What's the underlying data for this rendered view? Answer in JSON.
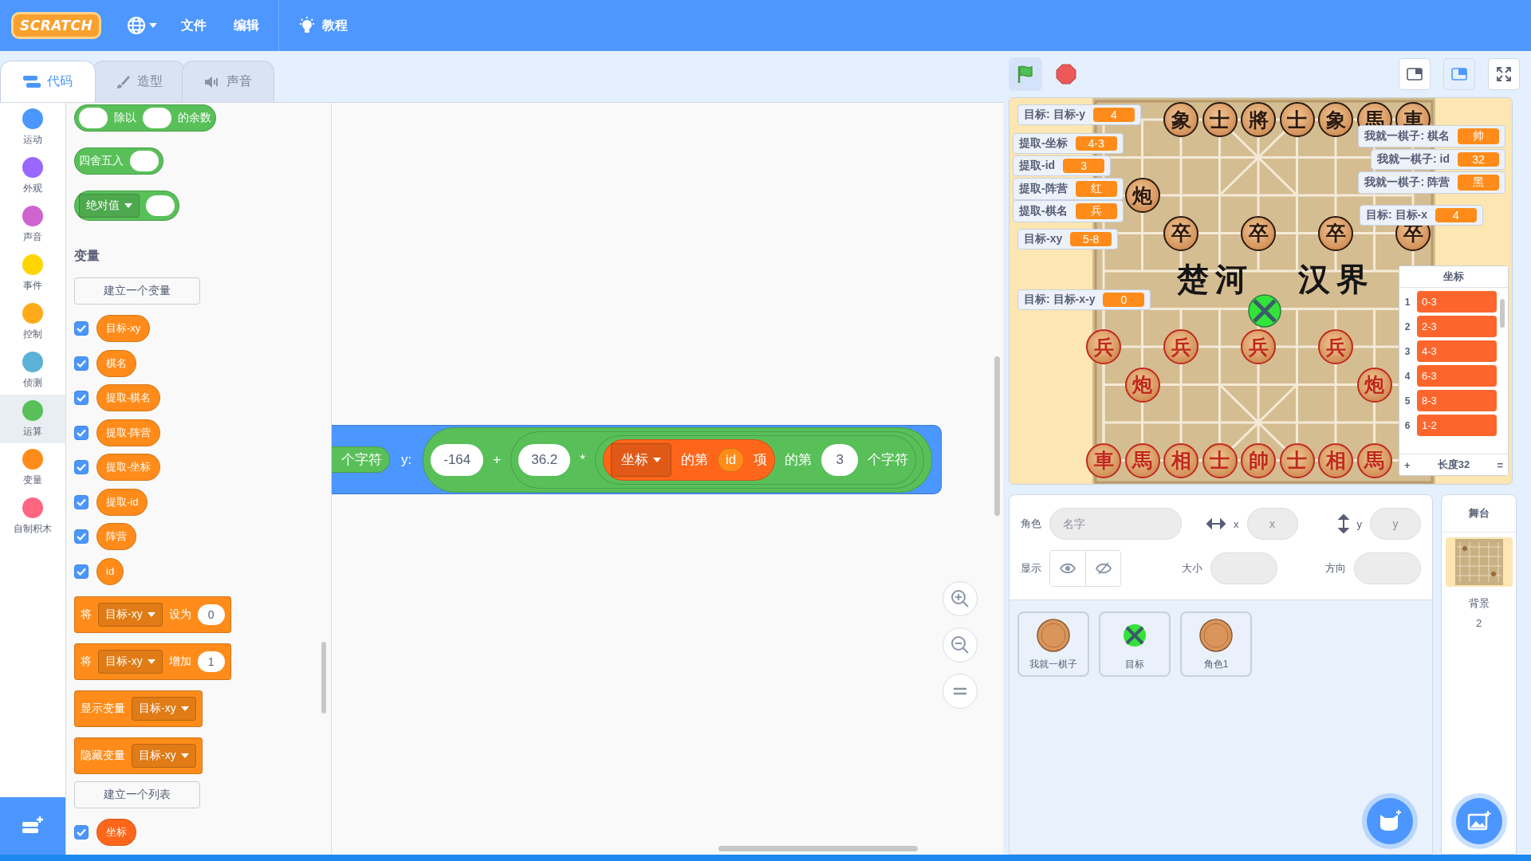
{
  "menu_bar": {
    "logo": "SCRATCH",
    "items": [
      {
        "label": "文件"
      },
      {
        "label": "编辑"
      }
    ],
    "tutorials": "教程"
  },
  "tabs": [
    {
      "label": "代码",
      "selected": true
    },
    {
      "label": "造型",
      "selected": false
    },
    {
      "label": "声音",
      "selected": false
    }
  ],
  "categories": [
    {
      "label": "运动",
      "color": "#4c97ff",
      "selected": false
    },
    {
      "label": "外观",
      "color": "#9966ff",
      "selected": false
    },
    {
      "label": "声音",
      "color": "#cf63cf",
      "selected": false
    },
    {
      "label": "事件",
      "color": "#ffd500",
      "selected": false
    },
    {
      "label": "控制",
      "color": "#ffab19",
      "selected": false
    },
    {
      "label": "侦测",
      "color": "#5cb1d6",
      "selected": false
    },
    {
      "label": "运算",
      "color": "#59c059",
      "selected": true
    },
    {
      "label": "变量",
      "color": "#ff8c1a",
      "selected": false
    },
    {
      "label": "自制积木",
      "color": "#ff6680",
      "selected": false
    }
  ],
  "palette": {
    "items": [
      {
        "kind": "reporter",
        "color": "#59c059",
        "parts": [
          {
            "kind": "slot"
          },
          {
            "kind": "text",
            "text": "除以"
          },
          {
            "kind": "slot"
          },
          {
            "kind": "text",
            "text": "的余数"
          }
        ]
      },
      {
        "kind": "reporter",
        "color": "#59c059",
        "parts": [
          {
            "kind": "text",
            "text": "四舍五入"
          },
          {
            "kind": "slot"
          }
        ]
      },
      {
        "kind": "reporter",
        "color": "#59c059",
        "parts": [
          {
            "kind": "dropdown",
            "text": "绝对值"
          },
          {
            "kind": "slot"
          }
        ]
      },
      {
        "kind": "heading",
        "text": "变量"
      },
      {
        "kind": "button",
        "label": "建立一个变量"
      },
      {
        "kind": "checkbox",
        "label": "目标-xy",
        "checked": true,
        "color": "#ff8c1a"
      },
      {
        "kind": "checkbox",
        "label": "棋名",
        "checked": true,
        "color": "#ff8c1a"
      },
      {
        "kind": "checkbox",
        "label": "提取-棋名",
        "checked": true,
        "color": "#ff8c1a"
      },
      {
        "kind": "checkbox",
        "label": "提取-阵营",
        "checked": true,
        "color": "#ff8c1a"
      },
      {
        "kind": "checkbox",
        "label": "提取-坐标",
        "checked": true,
        "color": "#ff8c1a"
      },
      {
        "kind": "checkbox",
        "label": "提取-id",
        "checked": true,
        "color": "#ff8c1a"
      },
      {
        "kind": "checkbox",
        "label": "阵营",
        "checked": true,
        "color": "#ff8c1a"
      },
      {
        "kind": "checkbox",
        "label": "id",
        "checked": true,
        "color": "#ff8c1a"
      },
      {
        "kind": "command",
        "color": "#ff8c1a",
        "parts": [
          {
            "kind": "text",
            "text": "将"
          },
          {
            "kind": "dropdown",
            "text": "目标-xy"
          },
          {
            "kind": "text",
            "text": "设为"
          },
          {
            "kind": "input",
            "text": "0"
          }
        ]
      },
      {
        "kind": "command",
        "color": "#ff8c1a",
        "parts": [
          {
            "kind": "text",
            "text": "将"
          },
          {
            "kind": "dropdown",
            "text": "目标-xy"
          },
          {
            "kind": "text",
            "text": "增加"
          },
          {
            "kind": "input",
            "text": "1"
          }
        ]
      },
      {
        "kind": "command",
        "color": "#ff8c1a",
        "parts": [
          {
            "kind": "text",
            "text": "显示变量"
          },
          {
            "kind": "dropdown",
            "text": "目标-xy"
          }
        ]
      },
      {
        "kind": "command",
        "color": "#ff8c1a",
        "parts": [
          {
            "kind": "text",
            "text": "隐藏变量"
          },
          {
            "kind": "dropdown",
            "text": "目标-xy"
          }
        ]
      },
      {
        "kind": "button",
        "label": "建立一个列表"
      },
      {
        "kind": "checkbox",
        "label": "坐标",
        "checked": true,
        "color": "#ff661a"
      }
    ]
  },
  "script": {
    "kind": "stack",
    "color": "#4c97ff",
    "parts": [
      {
        "kind": "reporter",
        "color": "#59c059",
        "parts": [
          {
            "kind": "text",
            "text": "个字符"
          }
        ]
      },
      {
        "kind": "text",
        "text": "y:"
      },
      {
        "kind": "reporter",
        "color": "#59c059",
        "parts": [
          {
            "kind": "input",
            "text": "-164"
          },
          {
            "kind": "text",
            "text": "+"
          },
          {
            "kind": "reporter",
            "color": "#59c059",
            "parts": [
              {
                "kind": "input",
                "text": "36.2"
              },
              {
                "kind": "text",
                "text": "*"
              },
              {
                "kind": "reporter",
                "color": "#59c059",
                "parts": [
                  {
                    "kind": "reporter",
                    "color": "#ff661a",
                    "parts": [
                      {
                        "kind": "dropdown",
                        "text": "坐标"
                      },
                      {
                        "kind": "text",
                        "text": "的第"
                      },
                      {
                        "kind": "reporter",
                        "color": "#ff8c1a",
                        "parts": [
                          {
                            "kind": "text",
                            "text": "id"
                          }
                        ]
                      },
                      {
                        "kind": "text",
                        "text": "项"
                      }
                    ]
                  },
                  {
                    "kind": "text",
                    "text": "的第"
                  },
                  {
                    "kind": "input",
                    "text": "3"
                  },
                  {
                    "kind": "text",
                    "text": "个字符"
                  }
                ]
              }
            ]
          }
        ]
      }
    ]
  },
  "stage_modes": [
    {
      "kind": "small",
      "selected": false
    },
    {
      "kind": "normal",
      "selected": true
    }
  ],
  "stage": {
    "board": {
      "river_left": "楚河",
      "river_right": "汉界",
      "pieces": [
        {
          "char": "象",
          "color": "#2a1a10"
        },
        {
          "char": "士",
          "color": "#2a1a10"
        },
        {
          "char": "將",
          "color": "#2a1a10"
        },
        {
          "char": "士",
          "color": "#2a1a10"
        },
        {
          "char": "象",
          "color": "#2a1a10"
        },
        {
          "char": "馬",
          "color": "#2a1a10"
        },
        {
          "char": "車",
          "color": "#2a1a10"
        },
        {
          "char": "炮",
          "color": "#2a1a10"
        },
        {
          "char": "卒",
          "color": "#2a1a10"
        },
        {
          "char": "卒",
          "color": "#2a1a10"
        },
        {
          "char": "卒",
          "color": "#2a1a10"
        },
        {
          "char": "卒",
          "color": "#2a1a10"
        },
        {
          "char": "兵",
          "color": "#c0281e"
        },
        {
          "char": "兵",
          "color": "#c0281e"
        },
        {
          "char": "兵",
          "color": "#c0281e"
        },
        {
          "char": "兵",
          "color": "#c0281e"
        },
        {
          "char": "炮",
          "color": "#c0281e"
        },
        {
          "char": "炮",
          "color": "#c0281e"
        },
        {
          "char": "車",
          "color": "#c0281e"
        },
        {
          "char": "馬",
          "color": "#c0281e"
        },
        {
          "char": "相",
          "color": "#c0281e"
        },
        {
          "char": "士",
          "color": "#c0281e"
        },
        {
          "char": "帥",
          "color": "#c0281e"
        },
        {
          "char": "士",
          "color": "#c0281e"
        },
        {
          "char": "相",
          "color": "#c0281e"
        },
        {
          "char": "馬",
          "color": "#c0281e"
        }
      ]
    },
    "monitors": [
      {
        "label": "目标: 目标-y",
        "value": "4"
      },
      {
        "label": "提取-坐标",
        "value": "4-3"
      },
      {
        "label": "提取-id",
        "value": "3"
      },
      {
        "label": "提取-阵营",
        "value": "红"
      },
      {
        "label": "提取-棋名",
        "value": "兵"
      },
      {
        "label": "目标-xy",
        "value": "5-8"
      },
      {
        "label": "目标: 目标-x-y",
        "value": "0"
      },
      {
        "label": "我就一棋子: 棋名",
        "value": "帅"
      },
      {
        "label": "我就一棋子: id",
        "value": "32"
      },
      {
        "label": "我就一棋子: 阵营",
        "value": "黑"
      },
      {
        "label": "目标: 目标-x",
        "value": "4"
      }
    ],
    "list": {
      "title": "坐标",
      "items": [
        {
          "index": "1",
          "value": "0-3"
        },
        {
          "index": "2",
          "value": "2-3"
        },
        {
          "index": "3",
          "value": "4-3"
        },
        {
          "index": "4",
          "value": "6-3"
        },
        {
          "index": "5",
          "value": "8-3"
        },
        {
          "index": "6",
          "value": "1-2"
        }
      ],
      "add": "+",
      "length": "长度32",
      "resize": "="
    }
  },
  "sprite_info": {
    "sprite_label": "角色",
    "name_placeholder": "名字",
    "x_label": "x",
    "x_placeholder": "x",
    "y_label": "y",
    "y_placeholder": "y",
    "show_label": "显示",
    "size_label": "大小",
    "direction_label": "方向"
  },
  "sprites": [
    {
      "name": "我就一棋子",
      "kind": "piece"
    },
    {
      "name": "目标",
      "kind": "target"
    },
    {
      "name": "角色1",
      "kind": "piece"
    }
  ],
  "stage_pane": {
    "title": "舞台",
    "backdrops_label": "背景",
    "backdrop_count": "2"
  }
}
